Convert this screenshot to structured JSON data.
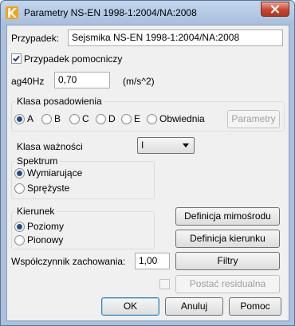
{
  "window": {
    "title": "Parametry NS-EN 1998-1:2004/NA:2008"
  },
  "case": {
    "label": "Przypadek:",
    "value": "Sejsmika NS-EN 1998-1:2004/NA:2008"
  },
  "aux_case": {
    "label": "Przypadek pomocniczy",
    "checked": true
  },
  "ag": {
    "label": "ag40Hz",
    "value": "0,70",
    "unit": "(m/s^2)"
  },
  "foundation": {
    "title": "Klasa posadowienia",
    "options": [
      "A",
      "B",
      "C",
      "D",
      "E",
      "Obwiednia"
    ],
    "selected": "A",
    "params_button": "Parametry"
  },
  "importance": {
    "label": "Klasa ważności",
    "value": "I"
  },
  "spectrum": {
    "title": "Spektrum",
    "options": [
      "Wymiarujące",
      "Sprężyste"
    ],
    "selected": "Wymiarujące"
  },
  "direction": {
    "title": "Kierunek",
    "options": [
      "Poziomy",
      "Pionowy"
    ],
    "selected": "Poziomy"
  },
  "buttons": {
    "eccentricity": "Definicja mimośrodu",
    "direction_def": "Definicja kierunku",
    "filters": "Filtry",
    "residual": "Postać residualna",
    "ok": "OK",
    "cancel": "Anuluj",
    "help": "Pomoc"
  },
  "behavior": {
    "label": "Współczynnik zachowania:",
    "value": "1,00"
  },
  "colors": {
    "accent": "#1f4f8a",
    "close": "#c9462c",
    "frame": "#aac0db"
  }
}
